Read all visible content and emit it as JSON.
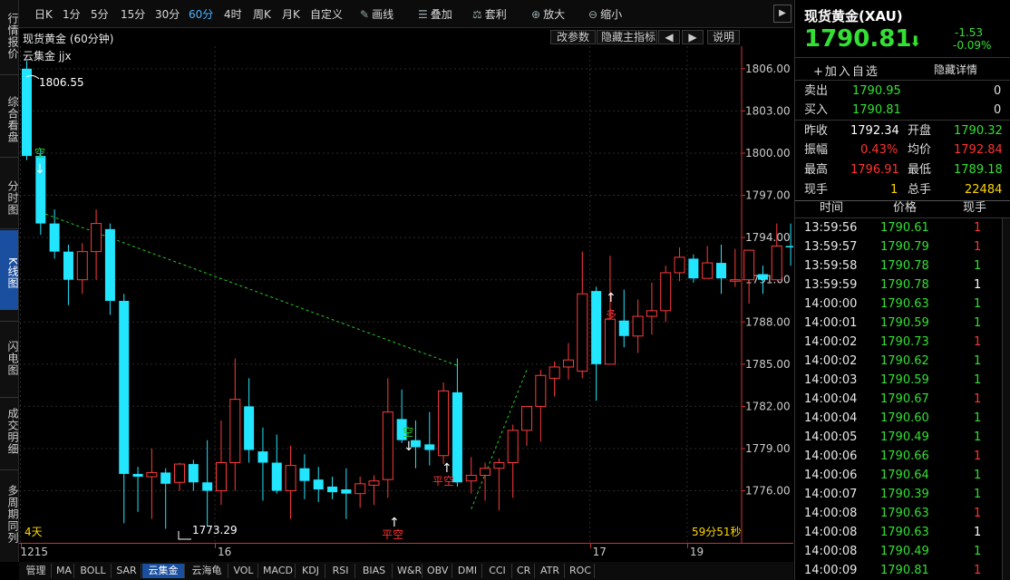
{
  "sidebar": {
    "items": [
      {
        "label": "行情报价",
        "active": false
      },
      {
        "label": "综合看盘",
        "active": false
      },
      {
        "label": "分时图",
        "active": false
      },
      {
        "label": "K线图",
        "active": true
      },
      {
        "label": "闪电图",
        "active": false
      },
      {
        "label": "成交明细",
        "active": false
      },
      {
        "label": "多周期同列",
        "active": false
      }
    ]
  },
  "toolbar": {
    "periods": [
      "日K",
      "1分",
      "5分",
      "15分",
      "30分",
      "60分",
      "4时",
      "周K",
      "月K",
      "自定义"
    ],
    "active_period": "60分",
    "tools": [
      {
        "label": "画线",
        "icon": "pencil-icon"
      },
      {
        "label": "叠加",
        "icon": "stack-icon"
      },
      {
        "label": "套利",
        "icon": "arbitrage-icon"
      },
      {
        "label": "放大",
        "icon": "zoom-in-icon"
      },
      {
        "label": "缩小",
        "icon": "zoom-out-icon"
      }
    ],
    "collapse": "▶"
  },
  "chart_header": {
    "title": "现货黄金 (60分钟)",
    "buttons": [
      "改参数",
      "隐藏主指标",
      "◀",
      "▶",
      "说明"
    ],
    "indicator": "云集金 jjx"
  },
  "chart_data": {
    "type": "candlestick",
    "ylim": [
      1772.3,
      1807.6
    ],
    "yticks": [
      "1806.00",
      "1803.00",
      "1800.00",
      "1797.00",
      "1794.00",
      "1791.00",
      "1788.00",
      "1785.00",
      "1782.00",
      "1779.00",
      "1776.00"
    ],
    "ytick_values": [
      1806,
      1803,
      1800,
      1797,
      1794,
      1791,
      1788,
      1785,
      1782,
      1779,
      1776
    ],
    "xticks": [
      {
        "label": "1215",
        "index": 0
      },
      {
        "label": "16",
        "index": 14
      },
      {
        "label": "17",
        "index": 41
      },
      {
        "label": "19",
        "index": 48
      }
    ],
    "candles": [
      [
        1806.0,
        1806.55,
        1799.5,
        1799.8
      ],
      [
        1799.8,
        1800.3,
        1794.2,
        1795.0
      ],
      [
        1795.0,
        1796.0,
        1792.5,
        1793.0
      ],
      [
        1793.0,
        1793.5,
        1789.2,
        1791.0
      ],
      [
        1791.0,
        1793.6,
        1790.0,
        1793.0
      ],
      [
        1793.0,
        1796.0,
        1791.0,
        1795.0
      ],
      [
        1794.6,
        1795.0,
        1788.5,
        1789.5
      ],
      [
        1789.5,
        1790.0,
        1773.7,
        1777.2
      ],
      [
        1777.2,
        1777.7,
        1774.5,
        1777.0
      ],
      [
        1777.0,
        1779.0,
        1774.0,
        1777.3
      ],
      [
        1777.3,
        1777.6,
        1773.3,
        1776.5
      ],
      [
        1776.6,
        1778.0,
        1776.0,
        1777.9
      ],
      [
        1777.9,
        1778.2,
        1776.0,
        1776.6
      ],
      [
        1776.6,
        1779.6,
        1773.5,
        1776.0
      ],
      [
        1776.0,
        1781.0,
        1775.0,
        1778.0
      ],
      [
        1778.0,
        1785.4,
        1776.0,
        1782.5
      ],
      [
        1782.0,
        1784.0,
        1778.0,
        1778.9
      ],
      [
        1778.8,
        1780.5,
        1775.3,
        1778.0
      ],
      [
        1778.0,
        1780.0,
        1775.8,
        1776.0
      ],
      [
        1776.0,
        1779.2,
        1774.0,
        1777.8
      ],
      [
        1777.6,
        1778.6,
        1775.4,
        1776.7
      ],
      [
        1776.8,
        1777.7,
        1775.2,
        1776.1
      ],
      [
        1776.3,
        1777.0,
        1775.4,
        1775.9
      ],
      [
        1776.1,
        1777.6,
        1774.0,
        1775.8
      ],
      [
        1775.8,
        1777.0,
        1774.8,
        1776.5
      ],
      [
        1776.4,
        1777.1,
        1775.0,
        1776.7
      ],
      [
        1776.8,
        1784.0,
        1775.5,
        1781.6
      ],
      [
        1781.1,
        1783.2,
        1779.4,
        1779.6
      ],
      [
        1779.6,
        1781.0,
        1777.6,
        1779.1
      ],
      [
        1779.3,
        1781.6,
        1777.8,
        1778.9
      ],
      [
        1778.5,
        1783.7,
        1777.9,
        1783.1
      ],
      [
        1783.0,
        1785.4,
        1776.3,
        1776.6
      ],
      [
        1776.7,
        1778.4,
        1775.8,
        1777.1
      ],
      [
        1777.1,
        1778.0,
        1775.3,
        1777.6
      ],
      [
        1777.6,
        1778.3,
        1774.6,
        1778.0
      ],
      [
        1778.0,
        1780.7,
        1775.5,
        1780.3
      ],
      [
        1780.3,
        1781.6,
        1779.2,
        1782.0
      ],
      [
        1782.0,
        1784.6,
        1779.5,
        1784.2
      ],
      [
        1784.0,
        1785.2,
        1782.7,
        1784.8
      ],
      [
        1784.8,
        1786.5,
        1783.9,
        1785.3
      ],
      [
        1784.5,
        1793.0,
        1784.0,
        1790.0
      ],
      [
        1790.2,
        1790.5,
        1782.4,
        1785.0
      ],
      [
        1785.0,
        1792.7,
        1787.0,
        1788.2
      ],
      [
        1788.1,
        1790.3,
        1786.2,
        1787.0
      ],
      [
        1787.0,
        1789.6,
        1785.8,
        1788.4
      ],
      [
        1788.4,
        1790.8,
        1787.1,
        1788.8
      ],
      [
        1788.8,
        1792.0,
        1788.0,
        1791.5
      ],
      [
        1791.5,
        1793.3,
        1790.9,
        1792.6
      ],
      [
        1792.5,
        1792.8,
        1790.8,
        1791.1
      ],
      [
        1791.1,
        1793.4,
        1791.3,
        1792.2
      ],
      [
        1792.2,
        1793.5,
        1790.0,
        1791.1
      ],
      [
        1790.9,
        1793.2,
        1790.5,
        1791.0
      ],
      [
        1791.0,
        1793.0,
        1789.3,
        1793.1
      ],
      [
        1791.4,
        1792.0,
        1790.0,
        1791.0
      ],
      [
        1791.0,
        1795.0,
        1791.0,
        1793.4
      ],
      [
        1793.4,
        1795.0,
        1792.0,
        1793.3
      ],
      [
        1792.1,
        1794.2,
        1791.8,
        1794.0
      ],
      [
        1794.0,
        1796.5,
        1792.0,
        1791.6
      ],
      [
        1793.6,
        1794.5,
        1791.6,
        1792.0
      ],
      [
        1792.2,
        1793.0,
        1790.0,
        1790.7
      ],
      [
        1790.7,
        1791.0,
        1790.0,
        1790.4
      ]
    ],
    "trendline": {
      "from_index": 1,
      "from_value": 1795.8,
      "to_index": 31,
      "to_value": 1784.9
    },
    "trendline2": {
      "from_index": 32,
      "from_value": 1774.7,
      "to_index": 36,
      "to_value": 1784.6
    },
    "labels": {
      "high": "1806.55",
      "low": "1773.29",
      "range_days": "4天",
      "countdown": "59分51秒",
      "short1": "空",
      "short2": "空",
      "flat1": "平空",
      "flat2": "平空",
      "long1": "多"
    }
  },
  "indicators": {
    "items": [
      "管理",
      "MA",
      "BOLL",
      "SAR",
      "云集金",
      "云海龟",
      "VOL",
      "MACD",
      "KDJ",
      "RSI",
      "BIAS",
      "W&R",
      "OBV",
      "DMI",
      "CCI",
      "CR",
      "ATR",
      "ROC"
    ],
    "active": "云集金"
  },
  "quote": {
    "title": "现货黄金(XAU)",
    "price": "1790.81",
    "arrow": "⬇",
    "change": "-1.53",
    "change_pct": "-0.09%",
    "add_watch": "+加入自选",
    "hide_detail": "隐藏详情",
    "sell_label": "卖出",
    "sell_price": "1790.95",
    "sell_qty": "0",
    "buy_label": "买入",
    "buy_price": "1790.81",
    "buy_qty": "0",
    "prev_close_label": "昨收",
    "prev_close": "1792.34",
    "open_label": "开盘",
    "open": "1790.32",
    "amplitude_label": "振幅",
    "amplitude": "0.43%",
    "avg_label": "均价",
    "avg": "1792.84",
    "high_label": "最高",
    "high": "1796.91",
    "low_label": "最低",
    "low": "1789.18",
    "vol_label": "现手",
    "vol": "1",
    "total_label": "总手",
    "total": "22484"
  },
  "ticks": {
    "headers": [
      "时间",
      "价格",
      "现手"
    ],
    "rows": [
      [
        "13:59:56",
        "1790.61",
        "1",
        "red"
      ],
      [
        "13:59:57",
        "1790.79",
        "1",
        "red"
      ],
      [
        "13:59:58",
        "1790.78",
        "1",
        "green"
      ],
      [
        "13:59:59",
        "1790.78",
        "1",
        "white"
      ],
      [
        "14:00:00",
        "1790.63",
        "1",
        "green"
      ],
      [
        "14:00:01",
        "1790.59",
        "1",
        "green"
      ],
      [
        "14:00:02",
        "1790.73",
        "1",
        "red"
      ],
      [
        "14:00:02",
        "1790.62",
        "1",
        "green"
      ],
      [
        "14:00:03",
        "1790.59",
        "1",
        "green"
      ],
      [
        "14:00:04",
        "1790.67",
        "1",
        "red"
      ],
      [
        "14:00:04",
        "1790.60",
        "1",
        "green"
      ],
      [
        "14:00:05",
        "1790.49",
        "1",
        "green"
      ],
      [
        "14:00:06",
        "1790.66",
        "1",
        "red"
      ],
      [
        "14:00:06",
        "1790.64",
        "1",
        "green"
      ],
      [
        "14:00:07",
        "1790.39",
        "1",
        "green"
      ],
      [
        "14:00:08",
        "1790.63",
        "1",
        "red"
      ],
      [
        "14:00:08",
        "1790.63",
        "1",
        "white"
      ],
      [
        "14:00:08",
        "1790.49",
        "1",
        "green"
      ],
      [
        "14:00:09",
        "1790.81",
        "1",
        "red"
      ]
    ]
  }
}
